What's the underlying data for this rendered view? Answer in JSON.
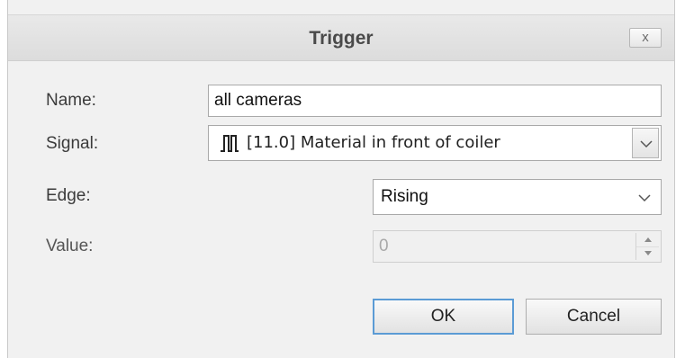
{
  "window": {
    "title": "Trigger",
    "close_label": "x"
  },
  "form": {
    "name": {
      "label": "Name:",
      "value": "all cameras"
    },
    "signal": {
      "label": "Signal:",
      "value": "[11.0] Material in front of coiler",
      "icon": "digital-signal-icon"
    },
    "edge": {
      "label": "Edge:",
      "value": "Rising"
    },
    "value": {
      "label": "Value:",
      "value": "0",
      "disabled": true
    }
  },
  "buttons": {
    "ok_label": "OK",
    "cancel_label": "Cancel"
  },
  "colors": {
    "title_bar": "#dcdcdc",
    "dialog_bg": "#f1f1f1",
    "focus_border": "#5b9bd5"
  }
}
